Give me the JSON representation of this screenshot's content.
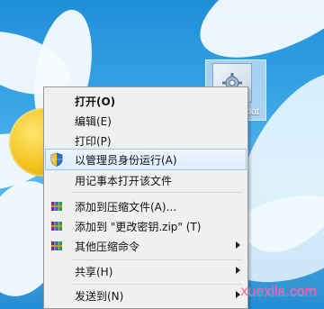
{
  "desktop": {
    "file": {
      "label": "bat"
    }
  },
  "context_menu": {
    "items": [
      {
        "label": "打开(O)"
      },
      {
        "label": "编辑(E)"
      },
      {
        "label": "打印(P)"
      },
      {
        "label": "以管理员身份运行(A)"
      },
      {
        "label": "用记事本打开该文件"
      },
      {
        "label": "添加到压缩文件(A)..."
      },
      {
        "label": "添加到 \"更改密钥.zip\" (T)"
      },
      {
        "label": "其他压缩命令"
      },
      {
        "label": "共享(H)"
      },
      {
        "label": "发送到(N)"
      }
    ]
  },
  "watermark": {
    "text": "xuexila.com"
  },
  "colors": {
    "menu_background": "#f0f0f0",
    "highlight_border": "#9cc8ef",
    "watermark": "#ff5aa8"
  }
}
